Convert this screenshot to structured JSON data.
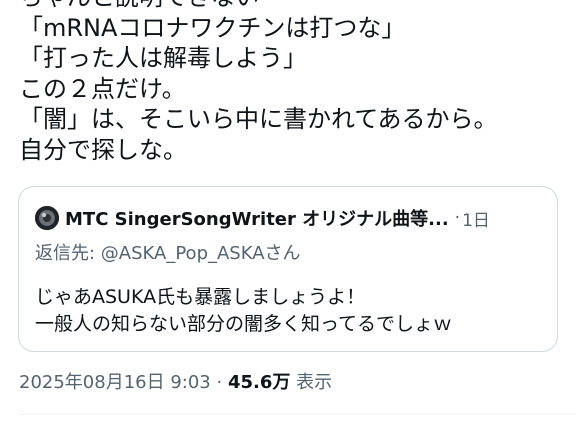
{
  "tweet": {
    "text": "ちゃんと説明できない\n「mRNAコロナワクチンは打つな」\n「打った人は解毒しよう」\nこの２点だけ。\n「闇」は、そこいら中に書かれてあるから。\n自分で探しな。"
  },
  "quote": {
    "author_name": "MTC SingerSongWriter オリジナル曲等...",
    "separator": "·",
    "age": "1日",
    "reply_prefix": "返信先: ",
    "reply_handle": "@ASKA_Pop_ASKA",
    "reply_suffix": "さん",
    "body": "じゃあASUKA氏も暴露しましょうよ！\n一般人の知らない部分の闇多く知ってるでしょｗ"
  },
  "meta": {
    "timestamp": "2025年08月16日 9:03",
    "separator": " · ",
    "views": "45.6万",
    "views_label": " 表示"
  }
}
